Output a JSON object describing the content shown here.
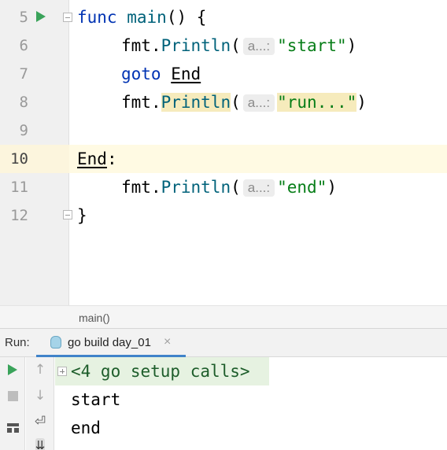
{
  "editor": {
    "lines": [
      {
        "number": "5",
        "kw": "func",
        "fn": "main",
        "rest": "() {"
      },
      {
        "number": "6",
        "pkg": "fmt",
        "dot": ".",
        "call": "Println",
        "open": "(",
        "hint": "a...:",
        "str": "\"start\"",
        "close": ")"
      },
      {
        "number": "7",
        "kw": "goto",
        "label": "End"
      },
      {
        "number": "8",
        "pkg": "fmt",
        "dot": ".",
        "call": "Println",
        "open": "(",
        "hint": "a...:",
        "str": "\"run...\"",
        "close": ")"
      },
      {
        "number": "9"
      },
      {
        "number": "10",
        "label": "End",
        "colon": ":"
      },
      {
        "number": "11",
        "pkg": "fmt",
        "dot": ".",
        "call": "Println",
        "open": "(",
        "hint": "a...:",
        "str": "\"end\"",
        "close": ")"
      },
      {
        "number": "12",
        "brace": "}"
      }
    ],
    "breadcrumb": "main()"
  },
  "run_panel": {
    "label": "Run:",
    "tab_title": "go build day_01",
    "close_glyph": "×",
    "console": {
      "folded_text": "<4 go setup calls>",
      "output": [
        "start",
        "end"
      ]
    },
    "toolbar": {
      "up_glyph": "↑",
      "down_glyph": "↓",
      "wrap_glyph": "⏎",
      "sort_glyph": "⇊"
    }
  },
  "colors": {
    "keyword": "#0033b3",
    "function": "#00627a",
    "string": "#067d17",
    "run_green": "#3aa35a",
    "current_line": "#fffae3"
  }
}
